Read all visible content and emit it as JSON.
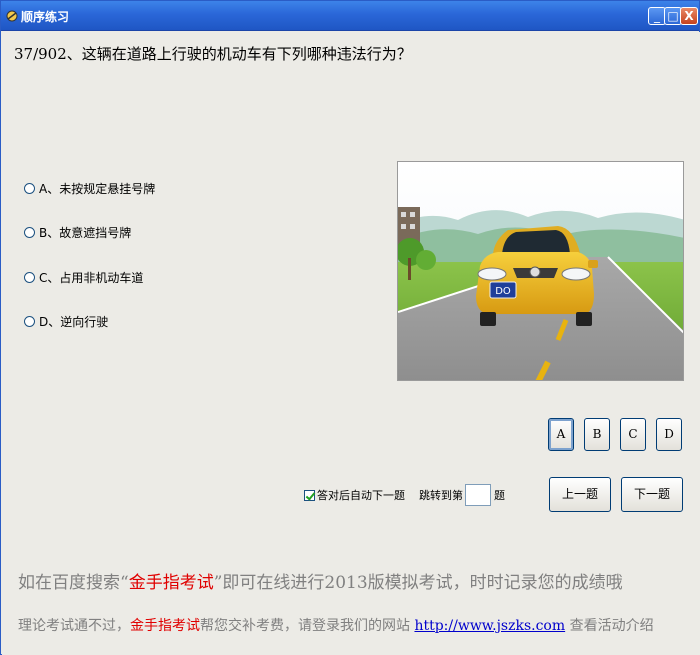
{
  "window": {
    "title": "顺序练习",
    "minimize_glyph": "_",
    "maximize_glyph": "□",
    "close_glyph": "X"
  },
  "question": {
    "text": "37/902、这辆在道路上行驶的机动车有下列哪种违法行为？"
  },
  "options": [
    {
      "label": "A、未按规定悬挂号牌"
    },
    {
      "label": "B、故意遮挡号牌"
    },
    {
      "label": "C、占用非机动车道"
    },
    {
      "label": "D、逆向行驶"
    }
  ],
  "answer_buttons": [
    {
      "label": "A"
    },
    {
      "label": "B"
    },
    {
      "label": "C"
    },
    {
      "label": "D"
    }
  ],
  "auto_next": {
    "label": "答对后自动下一题",
    "checked": true
  },
  "jump": {
    "prefix": "跳转到第",
    "value": "",
    "suffix": "题"
  },
  "nav": {
    "prev_label": "上一题",
    "next_label": "下一题"
  },
  "image": {
    "plate_text": "DO"
  },
  "promo": {
    "line1_pre": "如在百度搜索“",
    "line1_brand": "金手指考试",
    "line1_post": "”即可在线进行2013版模拟考试，时时记录您的成绩哦",
    "line2_pre": "理论考试通不过，",
    "line2_brand": "金手指考试",
    "line2_mid": "帮您交补考费，请登录我们的网站 ",
    "line2_link": "http://www.jszks.com",
    "line2_post": " 查看活动介绍"
  },
  "colors": {
    "titlebar": "#2a67d8",
    "promo_red": "#e00000",
    "link_blue": "#0000cc"
  }
}
